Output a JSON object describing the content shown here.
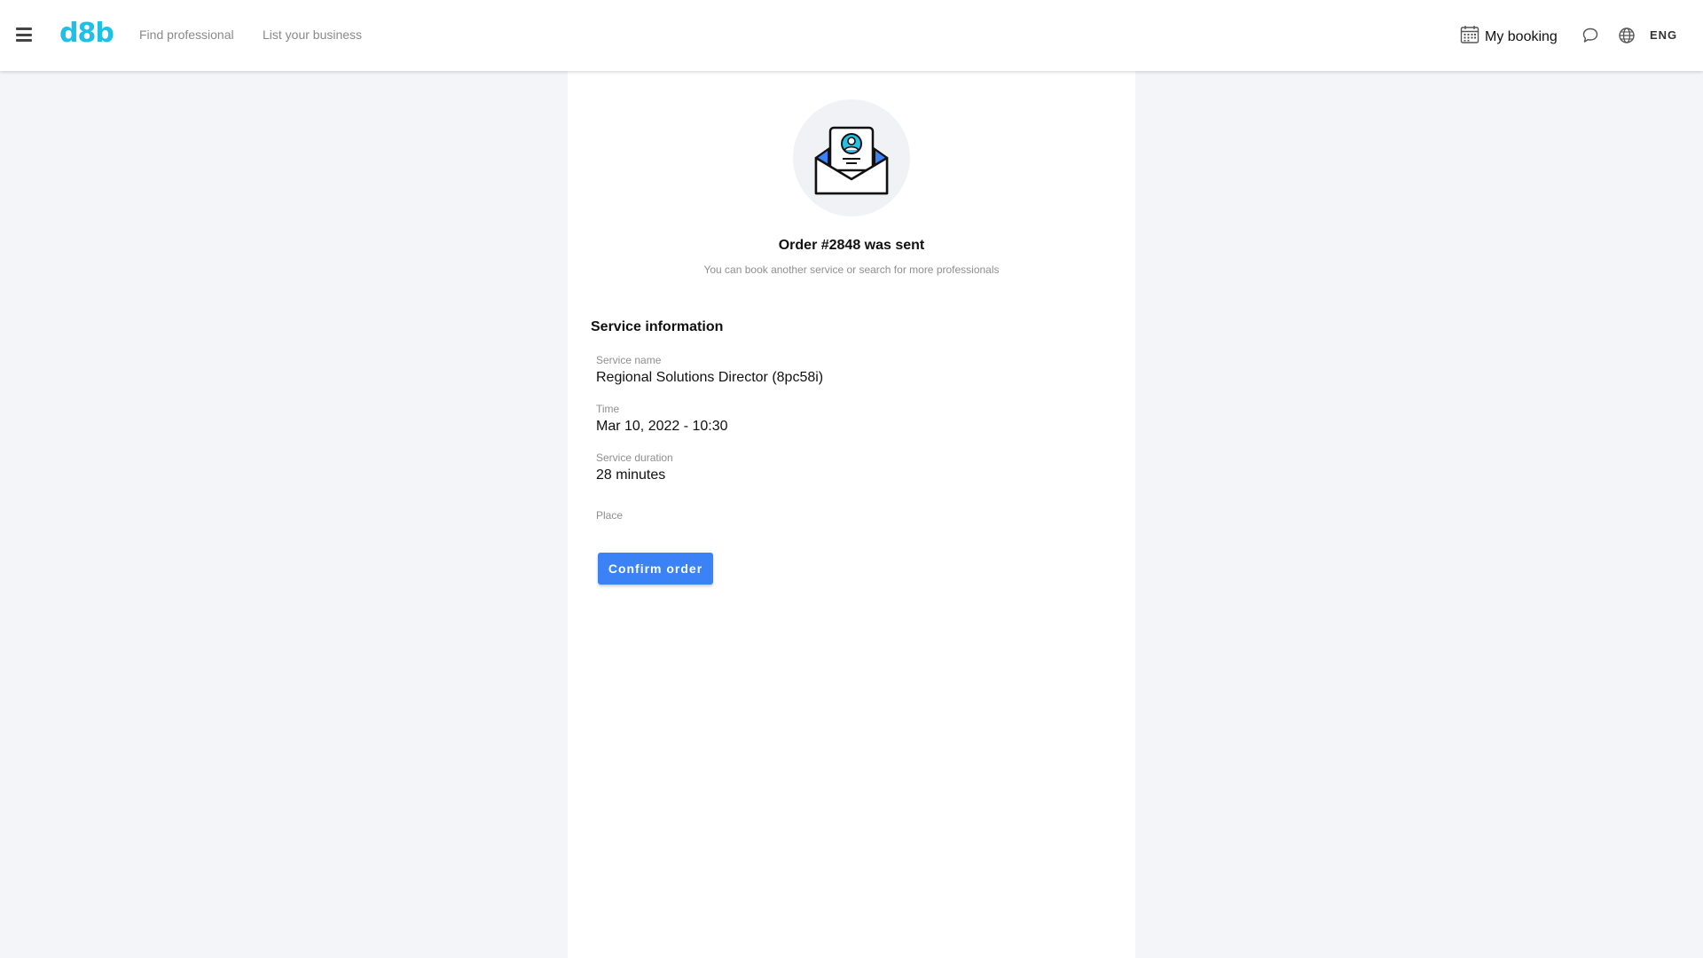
{
  "header": {
    "logo": "d8b",
    "nav": {
      "find_professional": "Find professional",
      "list_business": "List your business"
    },
    "my_booking": "My booking",
    "language": "ENG",
    "icons": {
      "menu": "hamburger-menu-icon",
      "calendar": "calendar-icon",
      "chat": "chat-icon",
      "globe": "globe-icon"
    }
  },
  "main": {
    "illustration_icon": "envelope-with-profile-icon",
    "title": "Order #2848 was sent",
    "subtitle": "You can book another service or search for more professionals",
    "section_title": "Service information",
    "fields": {
      "service_name_label": "Service name",
      "service_name_value": "Regional Solutions Director (8pc58i)",
      "time_label": "Time",
      "time_value": "Mar 10, 2022 - 10:30",
      "duration_label": "Service duration",
      "duration_value": "28 minutes",
      "place_label": "Place",
      "place_value": ""
    },
    "confirm_button": "Confirm order"
  },
  "colors": {
    "brand": "#1ec0e6",
    "primary_button": "#3b82f6",
    "page_background": "#f4f5f9",
    "muted_text": "#8f8f8f"
  }
}
